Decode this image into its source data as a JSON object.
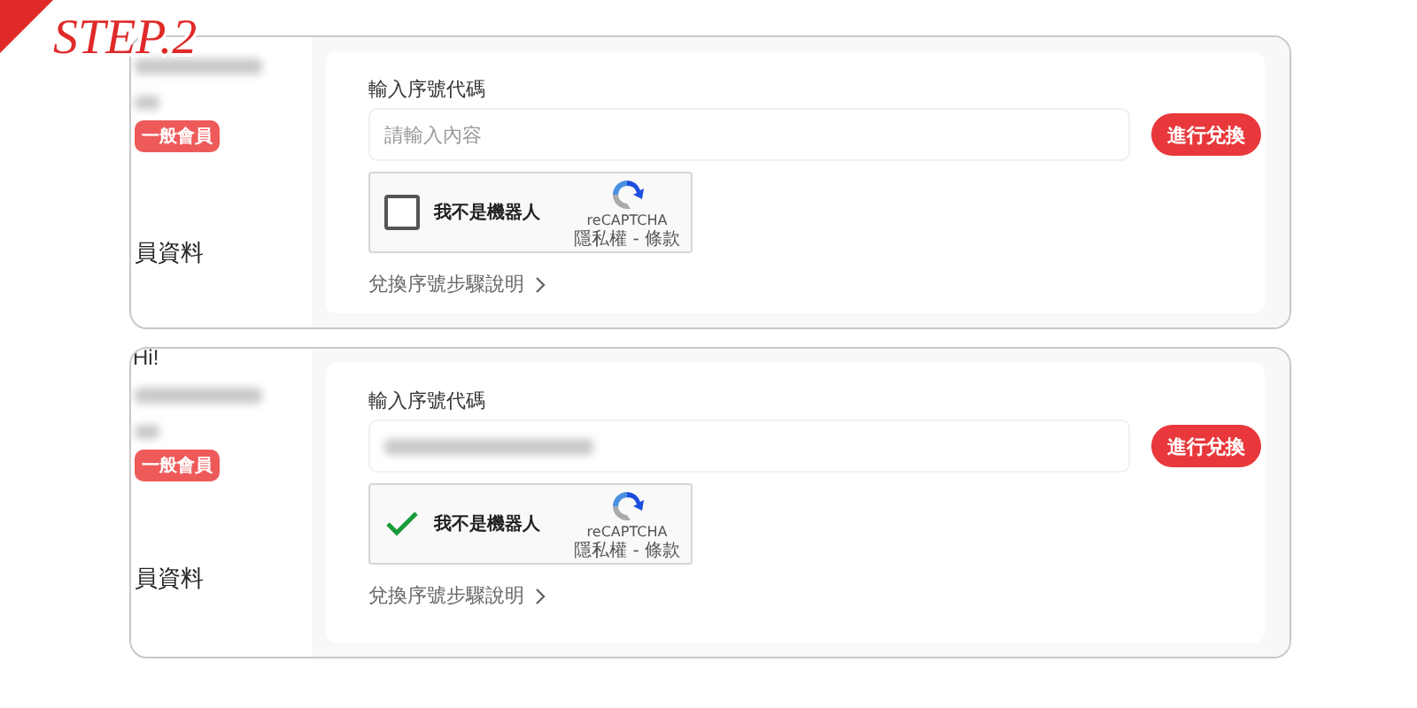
{
  "step_label": "STEP.2",
  "panels": [
    {
      "username_redacted": true,
      "member_badge": "一般會員",
      "profile_link": "員資料",
      "field_label": "輸入序號代碼",
      "input": {
        "placeholder": "請輸入內容",
        "redacted": false
      },
      "submit_button": "進行兌換",
      "captcha": {
        "label": "我不是機器人",
        "checked": false,
        "brand": "reCAPTCHA",
        "terms": "隱私權 - 條款"
      },
      "help_link": "兌換序號步驟說明"
    },
    {
      "greeting": "Hi!",
      "username_redacted": true,
      "member_badge": "一般會員",
      "profile_link": "員資料",
      "field_label": "輸入序號代碼",
      "input": {
        "redacted": true
      },
      "submit_button": "進行兌換",
      "captcha": {
        "label": "我不是機器人",
        "checked": true,
        "brand": "reCAPTCHA",
        "terms": "隱私權 - 條款"
      },
      "help_link": "兌換序號步驟說明"
    }
  ]
}
